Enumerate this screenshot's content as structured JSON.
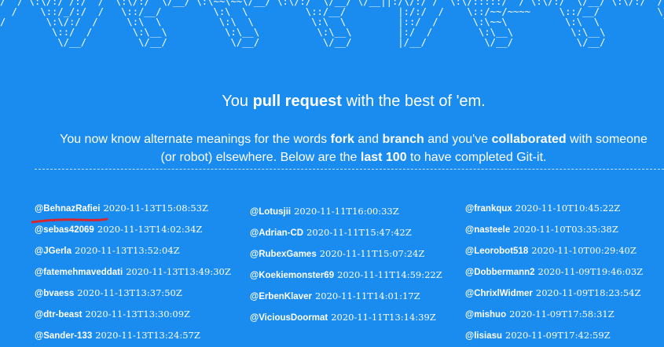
{
  "banner": {
    "ascii_art": "/  / \\:\\/:/ /:/  /  \\:\\/:/  \\/__/ \\:\\~~\\~~\\/__/ \\:\\/:/  \\/__/ \\/__||:/\\/:/ /  \\:\\/:::::/  / \\:\\/:/  \\/__/ \\:\\/:/  /     \\/\\:\\  \\__  \\:\\/:/  /\n  /    \\::/_/:/  /   \\::/__/         \\:\\  \\          \\::/__/         |:/:/  /    \\::/~~/~~~~     \\::/__/          \\::/__/          ~~\\:\\/\\__\\  \\::/_/:/\n/       \\:\\/:/  /     \\:\\  \\          \\:\\  \\          \\:\\  \\         |::/  /      \\:\\~~\\          \\:\\  \\           \\:\\  \\             \\::/  /    \\:\\/:/\n         \\::/  /       \\:\\__\\          \\:\\__\\          \\:\\__\\        |:/  /        \\:\\__\\          \\:\\__\\           \\:\\__\\            /:/  /      \\::/\n          \\/__/         \\/__/           \\/__/           \\/__/        |/__/          \\/__/           \\/__/            \\/__/           \\/__/        \\/__/"
  },
  "headline": {
    "prefix": "You ",
    "strong": "pull request",
    "suffix": " with the best of 'em."
  },
  "subtext": {
    "p1": "You now know alternate meanings for the words ",
    "b1": "fork",
    "p2": " and ",
    "b2": "branch",
    "p3": " and you've ",
    "b3": "collaborated",
    "p4": " with someone",
    "p5": "(or robot) elsewhere. Below are the ",
    "b4": "last 100",
    "p6": " to have completed Git-it."
  },
  "columns": [
    [
      {
        "user": "@BehnazRafiei",
        "time": "2020-11-13T15:08:53Z"
      },
      {
        "user": "@sebas42069",
        "time": "2020-11-13T14:02:34Z"
      },
      {
        "user": "@JGerla",
        "time": "2020-11-13T13:52:04Z"
      },
      {
        "user": "@fatemehmaveddati",
        "time": "2020-11-13T13:49:30Z"
      },
      {
        "user": "@bvaess",
        "time": "2020-11-13T13:37:50Z"
      },
      {
        "user": "@dtr-beast",
        "time": "2020-11-13T13:30:09Z"
      },
      {
        "user": "@Sander-133",
        "time": "2020-11-13T13:24:57Z"
      }
    ],
    [
      {
        "user": "@Lotusjii",
        "time": "2020-11-11T16:00:33Z"
      },
      {
        "user": "@Adrian-CD",
        "time": "2020-11-11T15:47:42Z"
      },
      {
        "user": "@RubexGames",
        "time": "2020-11-11T15:07:24Z"
      },
      {
        "user": "@Koekiemonster69",
        "time": "2020-11-11T14:59:22Z"
      },
      {
        "user": "@ErbenKlaver",
        "time": "2020-11-11T14:01:17Z"
      },
      {
        "user": "@ViciousDoormat",
        "time": "2020-11-11T13:14:39Z"
      }
    ],
    [
      {
        "user": "@frankqux",
        "time": "2020-11-10T10:45:22Z"
      },
      {
        "user": "@nasteele",
        "time": "2020-11-10T03:35:38Z"
      },
      {
        "user": "@Leorobot518",
        "time": "2020-11-10T00:29:40Z"
      },
      {
        "user": "@Dobbermann2",
        "time": "2020-11-09T19:46:03Z"
      },
      {
        "user": "@ChrixlWidmer",
        "time": "2020-11-09T18:23:54Z"
      },
      {
        "user": "@mishuo",
        "time": "2020-11-09T17:58:31Z"
      },
      {
        "user": "@lisiasu",
        "time": "2020-11-09T17:42:59Z"
      }
    ]
  ],
  "colors": {
    "background": "#1a8cf0",
    "text": "#ffffff",
    "annotation_mark": "#d9262c"
  }
}
